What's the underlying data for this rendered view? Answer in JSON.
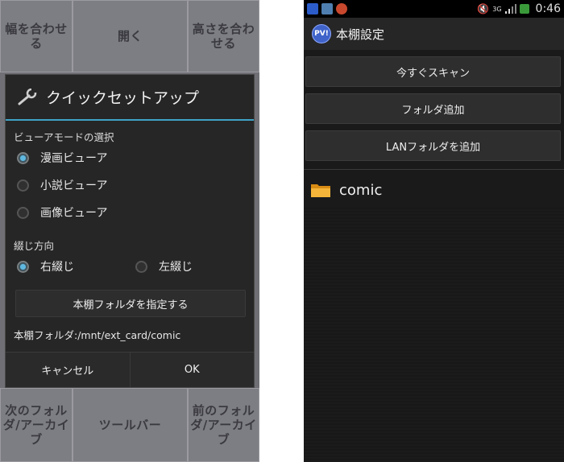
{
  "left": {
    "tiles_top": [
      "幅を合わせる",
      "開く",
      "高さを合わせる"
    ],
    "tiles_bottom": [
      "次のフォルダ/アーカイブ",
      "ツールバー",
      "前のフォルダ/アーカイブ"
    ],
    "dialog": {
      "title": "クイックセットアップ",
      "viewer_mode_label": "ビューアモードの選択",
      "viewer_options": [
        {
          "label": "漫画ビューア",
          "selected": true
        },
        {
          "label": "小説ビューア",
          "selected": false
        },
        {
          "label": "画像ビューア",
          "selected": false
        }
      ],
      "binding_label": "綴じ方向",
      "binding_options": [
        {
          "label": "右綴じ",
          "selected": true
        },
        {
          "label": "左綴じ",
          "selected": false
        }
      ],
      "set_folder_button": "本棚フォルダを指定する",
      "folder_path": "本棚フォルダ:/mnt/ext_card/comic",
      "cancel_button": "キャンセル",
      "ok_button": "OK"
    }
  },
  "right": {
    "status": {
      "time": "0:46",
      "signal": "3G"
    },
    "app_logo": "PV!",
    "title": "本棚設定",
    "buttons": [
      "今すぐスキャン",
      "フォルダ追加",
      "LANフォルダを追加"
    ],
    "folders": [
      {
        "name": "comic"
      }
    ]
  },
  "colors": {
    "accent": "#3ea3c7",
    "radio_on": "#5fb8e0",
    "folder": "#f2a825"
  }
}
